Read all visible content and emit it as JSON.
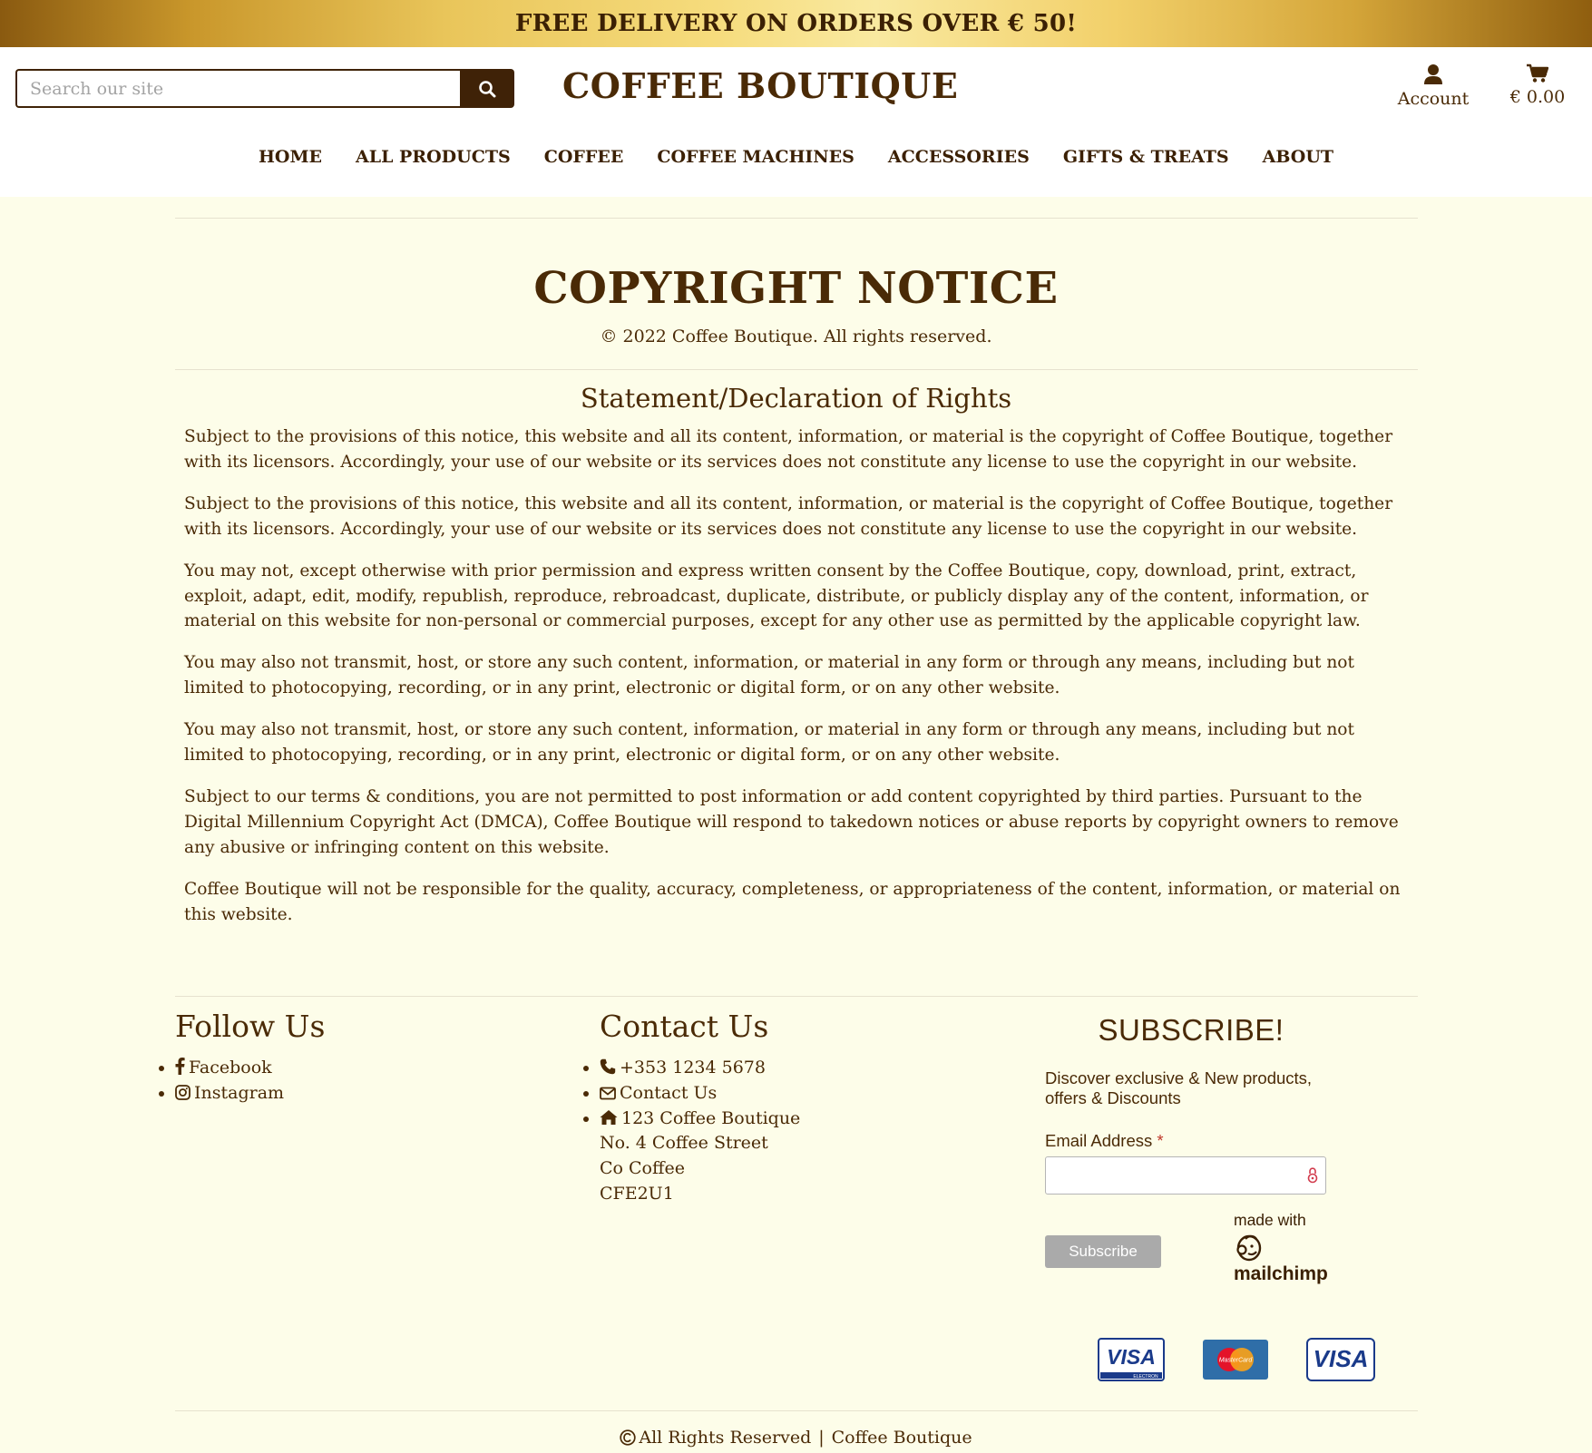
{
  "banner": {
    "text": "FREE DELIVERY ON ORDERS OVER € 50!"
  },
  "header": {
    "search_placeholder": "Search our site",
    "logo": "COFFEE BOUTIQUE",
    "account_label": "Account",
    "cart_total": "€ 0.00"
  },
  "nav": {
    "items": [
      "HOME",
      "ALL PRODUCTS",
      "COFFEE",
      "COFFEE MACHINES",
      "ACCESSORIES",
      "GIFTS & TREATS",
      "ABOUT"
    ]
  },
  "page": {
    "title": "COPYRIGHT NOTICE",
    "subtitle": "© 2022 Coffee Boutique. All rights reserved.",
    "section_title": "Statement/Declaration of Rights",
    "paragraphs": [
      "Subject to the provisions of this notice, this website and all its content, information, or material is the copyright of Coffee Boutique, together with its licensors. Accordingly, your use of our website or its services does not constitute any license to use the copyright in our website.",
      "Subject to the provisions of this notice, this website and all its content, information, or material is the copyright of Coffee Boutique, together with its licensors. Accordingly, your use of our website or its services does not constitute any license to use the copyright in our website.",
      "You may not, except otherwise with prior permission and express written consent by the Coffee Boutique, copy, download, print, extract, exploit, adapt, edit, modify, republish, reproduce, rebroadcast, duplicate, distribute, or publicly display any of the content, information, or material on this website for non-personal or commercial purposes, except for any other use as permitted by the applicable copyright law.",
      "You may also not transmit, host, or store any such content, information, or material in any form or through any means, including but not limited to photocopying, recording, or in any print, electronic or digital form, or on any other website.",
      "You may also not transmit, host, or store any such content, information, or material in any form or through any means, including but not limited to photocopying, recording, or in any print, electronic or digital form, or on any other website.",
      "Subject to our terms & conditions, you are not permitted to post information or add content copyrighted by third parties. Pursuant to the Digital Millennium Copyright Act (DMCA), Coffee Boutique will respond to takedown notices or abuse reports by copyright owners to remove any abusive or infringing content on this website.",
      "Coffee Boutique will not be responsible for the quality, accuracy, completeness, or appropriateness of the content, information, or material on this website."
    ]
  },
  "footer": {
    "follow": {
      "title": "Follow Us",
      "facebook": "Facebook",
      "instagram": "Instagram"
    },
    "contact": {
      "title": "Contact Us",
      "phone": "+353 1234 5678",
      "email_link": "Contact Us",
      "address_1": "123 Coffee Boutique",
      "address_2": "No. 4 Coffee Street",
      "address_3": "Co Coffee",
      "address_4": "CFE2U1"
    },
    "subscribe": {
      "title": "SUBSCRIBE!",
      "description": "Discover exclusive & New products, offers & Discounts",
      "email_label": "Email Address",
      "required_mark": "*",
      "button": "Subscribe",
      "made_with": "made with",
      "mailchimp": "mailchimp"
    },
    "payment_cards": {
      "visa_electron_brand": "VISA",
      "visa_electron_sub": "ELECTRON",
      "mastercard": "MasterCard",
      "visa": "VISA"
    },
    "bottom": {
      "rights": "All Rights Reserved",
      "separator": "|",
      "brand": "Coffee Boutique"
    }
  },
  "colors": {
    "brand_brown": "#4a2a06",
    "dark_button": "#3f2207",
    "page_background": "#fdfde9",
    "required": "#c0392b"
  },
  "icons": [
    "search-icon",
    "user-icon",
    "cart-icon",
    "facebook-icon",
    "instagram-icon",
    "phone-icon",
    "envelope-icon",
    "home-icon",
    "lock-icon",
    "mailchimp-icon",
    "copyright-icon"
  ]
}
